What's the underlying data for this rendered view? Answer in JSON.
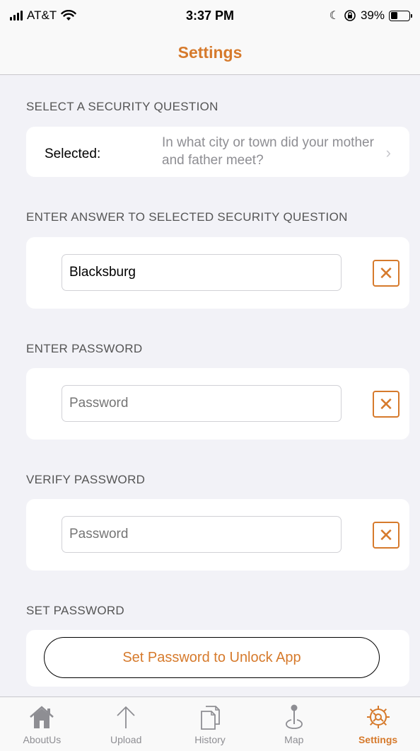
{
  "status_bar": {
    "carrier": "AT&T",
    "time": "3:37 PM",
    "battery": "39%",
    "battery_level": 0.39,
    "icons": [
      "signal-icon",
      "wifi-icon",
      "moon-icon",
      "orientation-lock-icon",
      "battery-icon"
    ]
  },
  "nav": {
    "title": "Settings"
  },
  "colors": {
    "accent": "#d67a2c",
    "background": "#f2f2f7",
    "card": "#ffffff",
    "secondary_text": "#8e8e93"
  },
  "security_question": {
    "header": "SELECT A SECURITY QUESTION",
    "selected_label": "Selected:",
    "question": "In what city or town did your mother and father meet?",
    "icon": "chevron-right-icon"
  },
  "answer": {
    "header": "ENTER ANSWER TO SELECTED SECURITY QUESTION",
    "value": "Blacksburg",
    "clear_icon": "close-icon"
  },
  "password": {
    "header": "ENTER PASSWORD",
    "placeholder": "Password",
    "clear_icon": "close-icon"
  },
  "verify_password": {
    "header": "VERIFY PASSWORD",
    "placeholder": "Password",
    "clear_icon": "close-icon"
  },
  "set_password": {
    "header": "SET PASSWORD",
    "button_label": "Set Password to Unlock App"
  },
  "tabs": [
    {
      "label": "AboutUs",
      "icon": "home-icon",
      "active": false
    },
    {
      "label": "Upload",
      "icon": "arrow-up-icon",
      "active": false
    },
    {
      "label": "History",
      "icon": "documents-icon",
      "active": false
    },
    {
      "label": "Map",
      "icon": "map-pin-icon",
      "active": false
    },
    {
      "label": "Settings",
      "icon": "gear-icon",
      "active": true
    }
  ]
}
